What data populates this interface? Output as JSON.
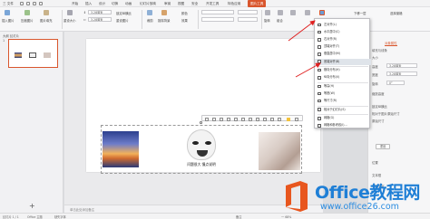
{
  "tabbar": {
    "items": [
      "三 文件",
      "日",
      "回",
      "回",
      "历",
      "",
      "开始",
      "插入",
      "设计",
      "切换",
      "动画",
      "幻灯片放映",
      "审阅",
      "视图",
      "安全",
      "开发工具",
      "特色应用",
      "图片工具"
    ],
    "active": "图片工具"
  },
  "ribbon": {
    "insert_picture": "插入图片",
    "compress": "压缩图片",
    "fill": "图片填充",
    "resize": "重设大小",
    "height_value": "3.28厘米",
    "width_value": "3.28厘米",
    "crop": "裁剪",
    "lock": "锁定纵横比",
    "reset": "重设图片",
    "remove_bg": "抠除背景",
    "color": "颜色",
    "effects": "效果",
    "rotate": "旋转",
    "align": "对齐",
    "combine": "组合",
    "up_layer": "上移一层",
    "down_layer": "下移一层",
    "select_pane": "选择窗格"
  },
  "dropdown": {
    "items": [
      "左对齐(L)",
      "水平居中(C)",
      "右对齐(R)",
      "顶端对齐(T)",
      "垂直居中(M)",
      "底端对齐(B)",
      "横向分布(H)",
      "纵向分布(V)",
      "等高(H)",
      "等宽(W)",
      "等尺寸(R)",
      "相对于幻灯片(S)",
      "网格(G)",
      "网格和参考线(I)..."
    ],
    "highlighted_index": 5
  },
  "left_panel": {
    "tabs": "大纲  幻灯片",
    "slide_number": "1",
    "add_label": "+"
  },
  "canvas": {
    "meme_caption": "问题很大 慢点说明",
    "notes": "单击此处添加备注"
  },
  "right_panel": {
    "tab_object": "对象属性",
    "tab_picture": "填充与线条",
    "size_label": "大小",
    "height_label": "高度",
    "height_value": "3.28厘米",
    "width_label": "宽度",
    "width_value": "3.28厘米",
    "rotate_label": "旋转",
    "rotate_value": "0°",
    "scale_label": "缩放高度",
    "lock_label": "锁定纵横比",
    "relative_label": "相对于图片原始尺寸",
    "original_label": "原始尺寸",
    "reset_button": "重设",
    "position_label": "位置",
    "text_label": "文本框",
    "alt_label": "可选文字"
  },
  "statusbar": {
    "slide_info": "幻灯片 1 / 1",
    "theme": "Office 主题",
    "missing_font": "缺失字体",
    "notes_btn": "备注",
    "zoom": "一 68%"
  },
  "watermark": {
    "title": "Office教程网",
    "url": "www.office26.com"
  },
  "colors": {
    "accent": "#d9562d",
    "arrow": "#e02020",
    "watermark_blue": "#1f7fd6",
    "logo_orange": "#e8561e"
  }
}
